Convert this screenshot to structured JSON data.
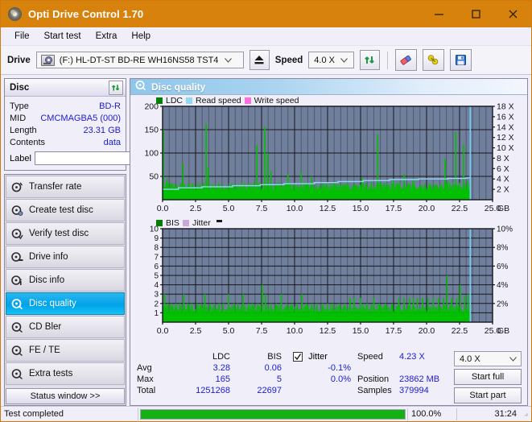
{
  "window": {
    "title": "Opti Drive Control 1.70",
    "app_icon": "disc-icon",
    "minimize": "minimize-icon",
    "maximize": "maximize-icon",
    "close": "close-icon",
    "accent": "#d8820e"
  },
  "menubar": {
    "items": [
      "File",
      "Start test",
      "Extra",
      "Help"
    ]
  },
  "toolbar": {
    "drive_label": "Drive",
    "drive_value": "(F:)  HL-DT-ST BD-RE  WH16NS58 TST4",
    "eject_icon": "eject-icon",
    "speed_label": "Speed",
    "speed_value": "4.0 X",
    "refresh_icon": "refresh-icon",
    "erase_icon": "eraser-icon",
    "settings_icon": "plug-icon",
    "save_icon": "floppy-save-icon"
  },
  "disc": {
    "header": "Disc",
    "refresh_icon": "refresh-icon",
    "rows": [
      {
        "key": "Type",
        "value": "BD-R"
      },
      {
        "key": "MID",
        "value": "CMCMAGBA5 (000)"
      },
      {
        "key": "Length",
        "value": "23.31 GB"
      },
      {
        "key": "Contents",
        "value": "data"
      }
    ],
    "label_key": "Label",
    "label_value": "",
    "label_placeholder": "",
    "disc_btn_icon": "cd-disc-icon"
  },
  "nav": {
    "items": [
      {
        "label": "Transfer rate",
        "icon": "disc-transfer-icon",
        "selected": false
      },
      {
        "label": "Create test disc",
        "icon": "disc-create-icon",
        "selected": false
      },
      {
        "label": "Verify test disc",
        "icon": "disc-verify-icon",
        "selected": false
      },
      {
        "label": "Drive info",
        "icon": "disc-drive-icon",
        "selected": false
      },
      {
        "label": "Disc info",
        "icon": "disc-info-icon",
        "selected": false
      },
      {
        "label": "Disc quality",
        "icon": "disc-quality-icon",
        "selected": true
      },
      {
        "label": "CD Bler",
        "icon": "disc-bler-icon",
        "selected": false
      },
      {
        "label": "FE / TE",
        "icon": "disc-fete-icon",
        "selected": false
      },
      {
        "label": "Extra tests",
        "icon": "disc-extra-icon",
        "selected": false
      }
    ],
    "status_button": "Status window >>"
  },
  "panel": {
    "header": "Disc quality",
    "header_icon": "disc-quality-icon"
  },
  "chart_data": [
    {
      "type": "line",
      "id": "ldc-chart",
      "title": "",
      "xlabel": "GB",
      "ylabel": "",
      "xlim": [
        0,
        25.0
      ],
      "ylim": [
        0,
        200
      ],
      "y2lim": [
        0,
        18
      ],
      "grid": true,
      "legend_position": "top-left",
      "legend": [
        {
          "name": "LDC",
          "color": "#00a000"
        },
        {
          "name": "Read speed",
          "color": "#8fd8f6"
        },
        {
          "name": "Write speed",
          "color": "#ff6ee0"
        }
      ],
      "xticks": [
        "0.0",
        "2.5",
        "5.0",
        "7.5",
        "10.0",
        "12.5",
        "15.0",
        "17.5",
        "20.0",
        "22.5",
        "25.0"
      ],
      "yticks": [
        "50",
        "100",
        "150",
        "200"
      ],
      "y2ticks": [
        "2 X",
        "4 X",
        "6 X",
        "8 X",
        "10 X",
        "12 X",
        "14 X",
        "16 X",
        "18 X"
      ],
      "x_unit": "GB",
      "data_end_gb": 23.31,
      "plot_bg": "#707f9b",
      "series": [
        {
          "name": "LDC",
          "color": "#00c000",
          "type": "bar",
          "baseline": 20,
          "peaks": [
            [
              0.05,
              150
            ],
            [
              0.35,
              45
            ],
            [
              0.6,
              30
            ],
            [
              1.0,
              28
            ],
            [
              1.55,
              78
            ],
            [
              1.9,
              30
            ],
            [
              2.3,
              34
            ],
            [
              3.3,
              163
            ],
            [
              3.45,
              68
            ],
            [
              3.8,
              30
            ],
            [
              4.3,
              34
            ],
            [
              4.8,
              28
            ],
            [
              5.4,
              30
            ],
            [
              6.0,
              33
            ],
            [
              6.6,
              30
            ],
            [
              7.15,
              118
            ],
            [
              7.4,
              36
            ],
            [
              7.75,
              156
            ],
            [
              7.95,
              100
            ],
            [
              8.2,
              62
            ],
            [
              8.6,
              34
            ],
            [
              9.1,
              30
            ],
            [
              9.5,
              56
            ],
            [
              9.9,
              32
            ],
            [
              10.5,
              60
            ],
            [
              10.9,
              36
            ],
            [
              11.3,
              50
            ],
            [
              11.9,
              30
            ],
            [
              12.4,
              32
            ],
            [
              13.0,
              34
            ],
            [
              13.5,
              30
            ],
            [
              14.0,
              35
            ],
            [
              14.6,
              32
            ],
            [
              15.1,
              48
            ],
            [
              15.4,
              35
            ],
            [
              16.3,
              140
            ],
            [
              16.9,
              30
            ],
            [
              17.5,
              42
            ],
            [
              17.9,
              33
            ],
            [
              18.3,
              55
            ],
            [
              18.6,
              30
            ],
            [
              19.0,
              45
            ],
            [
              19.6,
              30
            ],
            [
              20.2,
              34
            ],
            [
              20.8,
              30
            ],
            [
              21.4,
              88
            ],
            [
              21.6,
              40
            ],
            [
              22.2,
              145
            ],
            [
              22.5,
              36
            ],
            [
              22.8,
              118
            ],
            [
              23.1,
              40
            ]
          ]
        },
        {
          "name": "Read speed",
          "color": "#8fd8f6",
          "type": "step",
          "points": [
            [
              0,
              2.0
            ],
            [
              1.2,
              2.3
            ],
            [
              3.0,
              2.5
            ],
            [
              5.3,
              2.7
            ],
            [
              7.4,
              2.9
            ],
            [
              9.2,
              3.1
            ],
            [
              11.5,
              3.3
            ],
            [
              13.3,
              3.5
            ],
            [
              15.2,
              3.7
            ],
            [
              17.2,
              3.9
            ],
            [
              19.4,
              4.0
            ],
            [
              21.6,
              4.1
            ],
            [
              23.0,
              4.2
            ],
            [
              23.3,
              4.2
            ]
          ]
        }
      ]
    },
    {
      "type": "line",
      "id": "bis-chart",
      "title": "",
      "xlabel": "GB",
      "ylabel": "",
      "xlim": [
        0,
        25.0
      ],
      "ylim": [
        0,
        10
      ],
      "y2lim": [
        0,
        10
      ],
      "grid": true,
      "legend_position": "top-left",
      "legend": [
        {
          "name": "BIS",
          "color": "#00a000"
        },
        {
          "name": "Jitter",
          "color": "#c9a8d8"
        }
      ],
      "xticks": [
        "0.0",
        "2.5",
        "5.0",
        "7.5",
        "10.0",
        "12.5",
        "15.0",
        "17.5",
        "20.0",
        "22.5",
        "25.0"
      ],
      "yticks": [
        "1",
        "2",
        "3",
        "4",
        "5",
        "6",
        "7",
        "8",
        "9",
        "10"
      ],
      "y2ticks": [
        "2%",
        "4%",
        "6%",
        "8%",
        "10%"
      ],
      "x_unit": "GB",
      "data_end_gb": 23.31,
      "plot_bg": "#707f9b",
      "series": [
        {
          "name": "BIS",
          "color": "#00c000",
          "type": "bar",
          "baseline": 1.0,
          "peaks": [
            [
              0.15,
              3
            ],
            [
              0.4,
              2
            ],
            [
              0.7,
              2
            ],
            [
              1.0,
              2
            ],
            [
              1.3,
              2
            ],
            [
              1.6,
              3
            ],
            [
              1.9,
              2
            ],
            [
              2.2,
              2
            ],
            [
              2.6,
              2
            ],
            [
              2.9,
              2
            ],
            [
              3.2,
              3
            ],
            [
              3.6,
              2
            ],
            [
              3.9,
              2
            ],
            [
              4.3,
              2
            ],
            [
              4.6,
              2
            ],
            [
              5.0,
              3
            ],
            [
              5.4,
              2
            ],
            [
              5.7,
              2
            ],
            [
              6.1,
              3
            ],
            [
              6.5,
              2
            ],
            [
              6.8,
              2
            ],
            [
              7.2,
              2
            ],
            [
              7.55,
              4
            ],
            [
              7.8,
              3
            ],
            [
              8.2,
              2
            ],
            [
              8.6,
              2
            ],
            [
              9.0,
              3
            ],
            [
              9.4,
              2
            ],
            [
              9.8,
              2
            ],
            [
              10.2,
              2
            ],
            [
              10.55,
              3
            ],
            [
              10.9,
              2
            ],
            [
              11.3,
              2
            ],
            [
              11.7,
              2
            ],
            [
              12.1,
              2
            ],
            [
              12.5,
              2
            ],
            [
              12.9,
              2
            ],
            [
              13.4,
              2
            ],
            [
              13.8,
              2
            ],
            [
              14.2,
              2.6
            ],
            [
              14.5,
              2.6
            ],
            [
              15.0,
              2.6
            ],
            [
              15.5,
              2
            ],
            [
              16.0,
              2.6
            ],
            [
              16.4,
              2
            ],
            [
              16.9,
              2
            ],
            [
              17.4,
              2
            ],
            [
              17.9,
              2.6
            ],
            [
              18.3,
              2.6
            ],
            [
              18.7,
              2.6
            ],
            [
              19.0,
              2.6
            ],
            [
              19.3,
              2.6
            ],
            [
              19.7,
              2.6
            ],
            [
              20.1,
              2.6
            ],
            [
              20.5,
              2.6
            ],
            [
              20.9,
              2.6
            ],
            [
              21.3,
              2.6
            ],
            [
              21.55,
              5
            ],
            [
              21.9,
              2.6
            ],
            [
              22.3,
              2.6
            ],
            [
              22.55,
              4
            ],
            [
              22.9,
              2.8
            ],
            [
              23.15,
              3
            ]
          ]
        }
      ]
    }
  ],
  "stats": {
    "columns": [
      "LDC",
      "BIS"
    ],
    "rows": [
      {
        "label": "Avg",
        "ldc": "3.28",
        "bis": "0.06",
        "jitter": "-0.1%"
      },
      {
        "label": "Max",
        "ldc": "165",
        "bis": "5",
        "jitter": "0.0%"
      },
      {
        "label": "Total",
        "ldc": "1251268",
        "bis": "22697",
        "jitter": ""
      }
    ],
    "jitter_label": "Jitter",
    "jitter_checked": true,
    "speed_label": "Speed",
    "speed_value": "4.23 X",
    "position_label": "Position",
    "position_value": "23862 MB",
    "samples_label": "Samples",
    "samples_value": "379994",
    "speed_select": "4.0 X",
    "start_full": "Start full",
    "start_part": "Start part"
  },
  "statusbar": {
    "message": "Test completed",
    "progress_text": "100.0%",
    "progress_percent": 100,
    "elapsed": "31:24"
  }
}
